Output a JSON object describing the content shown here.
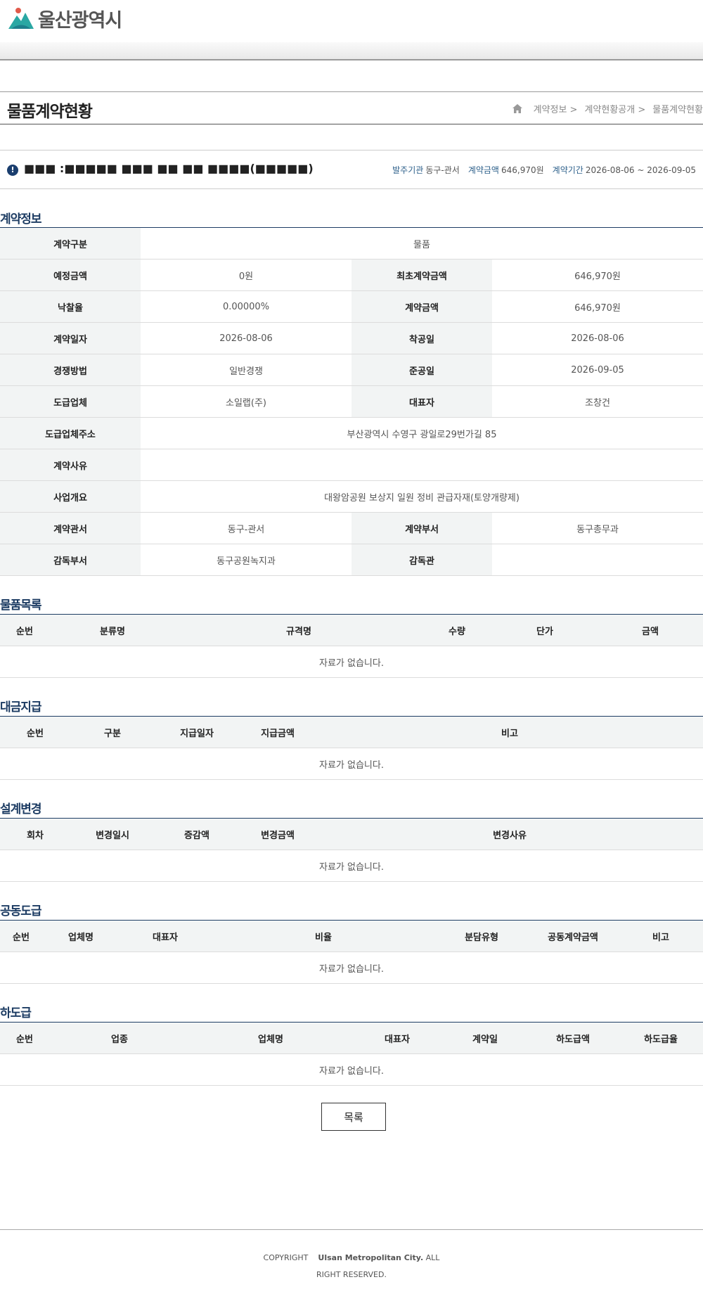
{
  "header": {
    "logo_text": "울산광역시"
  },
  "title_bar": {
    "page_title": "물품계약현황",
    "breadcrumb": [
      "계약정보 >",
      "계약현황공개 >",
      "물품계약현황"
    ]
  },
  "summary": {
    "title": "■■■ :■■■■■ ■■■ ■■ ■■ ■■■■(■■■■■)",
    "meta": [
      {
        "key": "발주기관",
        "value": "동구-관서"
      },
      {
        "key": "계약금액",
        "value": "646,970원"
      },
      {
        "key": "계약기간",
        "value": "2026-08-06 ~ 2026-09-05"
      }
    ]
  },
  "contract_info": {
    "title": "계약정보",
    "rows": [
      {
        "k1": "계약구분",
        "v1": "물품"
      },
      {
        "k1": "예정금액",
        "v1": "0원",
        "k2": "최초계약금액",
        "v2": "646,970원"
      },
      {
        "k1": "낙찰율",
        "v1": "0.00000%",
        "k2": "계약금액",
        "v2": "646,970원"
      },
      {
        "k1": "계약일자",
        "v1": "2026-08-06",
        "k2": "착공일",
        "v2": "2026-08-06"
      },
      {
        "k1": "경쟁방법",
        "v1": "일반경쟁",
        "k2": "준공일",
        "v2": "2026-09-05"
      },
      {
        "k1": "도급업체",
        "v1": "소일랩(주)",
        "k2": "대표자",
        "v2": "조창건"
      },
      {
        "k1": "도급업체주소",
        "v1": "부산광역시 수영구 광일로29번가길 85"
      },
      {
        "k1": "계약사유",
        "v1": ""
      },
      {
        "k1": "사업개요",
        "v1": "대왕암공원 보상지 일원 정비 관급자재(토양개량제)"
      },
      {
        "k1": "계약관서",
        "v1": "동구-관서",
        "k2": "계약부서",
        "v2": "동구총무과"
      },
      {
        "k1": "감독부서",
        "v1": "동구공원녹지과",
        "k2": "감독관",
        "v2": ""
      }
    ]
  },
  "goods_list": {
    "title": "물품목록",
    "columns": [
      "순번",
      "분류명",
      "규격명",
      "수량",
      "단가",
      "금액"
    ],
    "empty": "자료가 없습니다."
  },
  "payments": {
    "title": "대금지급",
    "columns": [
      "순번",
      "구분",
      "지급일자",
      "지급금액",
      "비고"
    ],
    "empty": "자료가 없습니다."
  },
  "design_changes": {
    "title": "설계변경",
    "columns": [
      "회차",
      "변경일시",
      "증감액",
      "변경금액",
      "변경사유"
    ],
    "empty": "자료가 없습니다."
  },
  "joint_contract": {
    "title": "공동도급",
    "columns": [
      "순번",
      "업체명",
      "대표자",
      "비율",
      "분담유형",
      "공동계약금액",
      "비고"
    ],
    "empty": "자료가 없습니다."
  },
  "subcontract": {
    "title": "하도급",
    "columns": [
      "순번",
      "업종",
      "업체명",
      "대표자",
      "계약일",
      "하도급액",
      "하도급율"
    ],
    "empty": "자료가 없습니다."
  },
  "buttons": {
    "list": "목록"
  },
  "footer": {
    "copyright": "COPYRIGHT",
    "org": "Ulsan Metropolitan City.",
    "rights": "ALL RIGHT RESERVED."
  },
  "colors": {
    "navy": "#1d3c63",
    "teal": "#2aa7a3",
    "header_bg": "#f2f4f4"
  }
}
